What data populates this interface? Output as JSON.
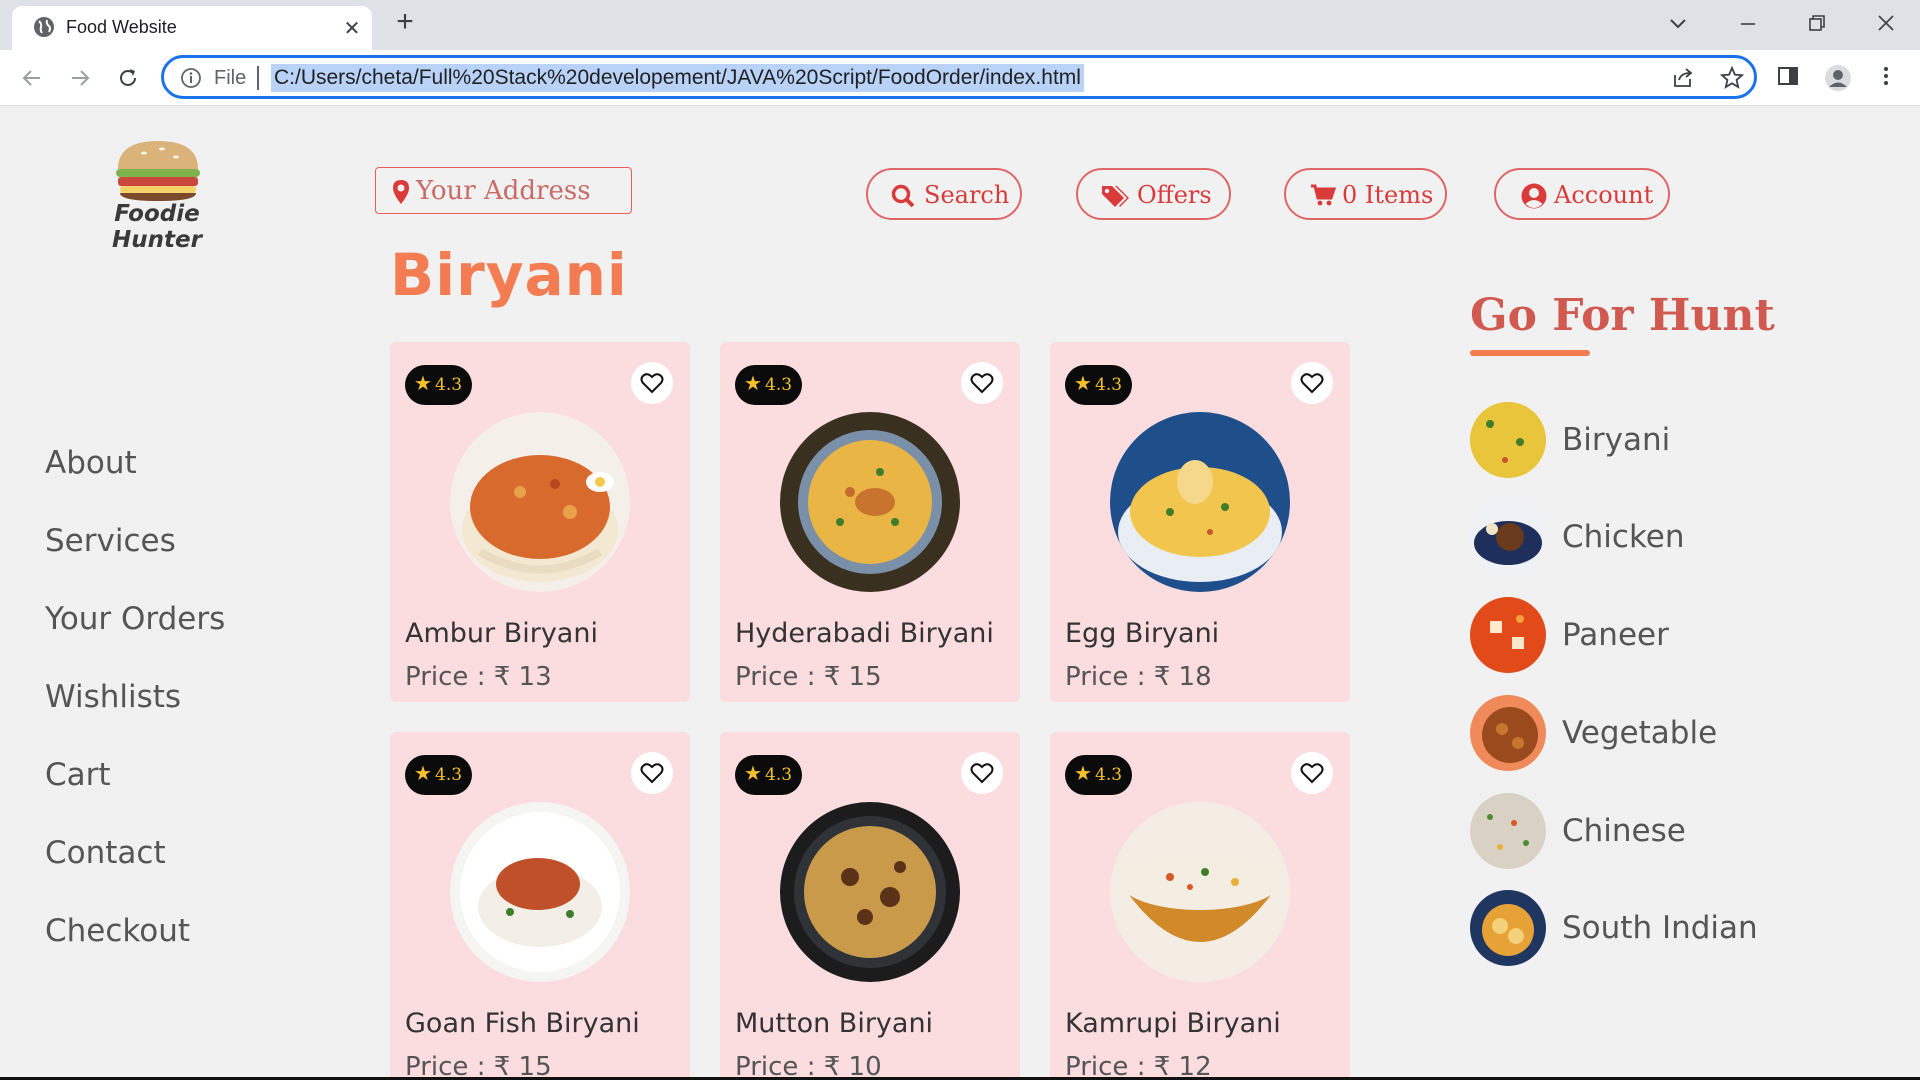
{
  "browser": {
    "tab_title": "Food Website",
    "new_tab": "+",
    "close": "✕",
    "omnibox_scheme": "File",
    "url": "C:/Users/cheta/Full%20Stack%20developement/JAVA%20Script/FoodOrder/index.html"
  },
  "header": {
    "logo_text": "Foodie Hunter",
    "address_placeholder": "Your Address",
    "buttons": {
      "search": "Search",
      "offers": "Offers",
      "cart": "0 Items",
      "account": "Account"
    }
  },
  "sidebar": {
    "items": [
      {
        "label": "About"
      },
      {
        "label": "Services"
      },
      {
        "label": "Your Orders"
      },
      {
        "label": "Wishlists"
      },
      {
        "label": "Cart"
      },
      {
        "label": "Contact"
      },
      {
        "label": "Checkout"
      }
    ]
  },
  "main": {
    "title": "Biryani",
    "cards": [
      {
        "rating": "4.3",
        "name": "Ambur Biryani",
        "price": "Price : ₹ 13"
      },
      {
        "rating": "4.3",
        "name": "Hyderabadi Biryani",
        "price": "Price : ₹ 15"
      },
      {
        "rating": "4.3",
        "name": "Egg Biryani",
        "price": "Price : ₹ 18"
      },
      {
        "rating": "4.3",
        "name": "Goan Fish Biryani",
        "price": "Price : ₹ 15"
      },
      {
        "rating": "4.3",
        "name": "Mutton Biryani",
        "price": "Price : ₹ 10"
      },
      {
        "rating": "4.3",
        "name": "Kamrupi Biryani",
        "price": "Price : ₹ 12"
      }
    ]
  },
  "hunt": {
    "title": "Go For Hunt",
    "categories": [
      {
        "label": "Biryani"
      },
      {
        "label": "Chicken"
      },
      {
        "label": "Paneer"
      },
      {
        "label": "Vegetable"
      },
      {
        "label": "Chinese"
      },
      {
        "label": "South Indian"
      }
    ]
  },
  "colors": {
    "accent": "#f47c52",
    "card_bg": "#fbdde0",
    "button_red": "#d93a3a",
    "rating_star": "#f6c02c"
  }
}
